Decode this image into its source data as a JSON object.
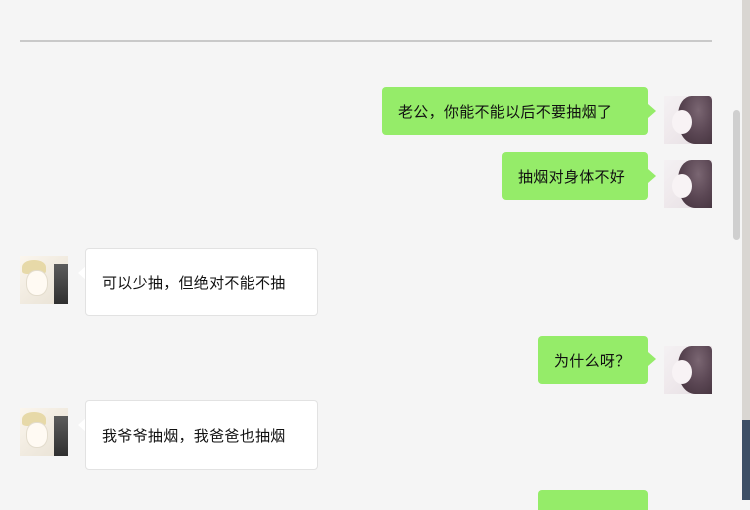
{
  "chat": {
    "messages": [
      {
        "side": "right",
        "sender": "wife",
        "text": "老公，你能不能以后不要抽烟了"
      },
      {
        "side": "right",
        "sender": "wife",
        "text": "抽烟对身体不好"
      },
      {
        "side": "left",
        "sender": "husband",
        "text": "可以少抽，但绝对不能不抽"
      },
      {
        "side": "right",
        "sender": "wife",
        "text": "为什么呀？"
      },
      {
        "side": "left",
        "sender": "husband",
        "text": "我爷爷抽烟，我爸爸也抽烟"
      }
    ]
  },
  "colors": {
    "outgoing_bubble": "#95ec69",
    "incoming_bubble": "#ffffff",
    "background": "#f5f5f5"
  },
  "icons": {
    "wife_avatar": "user-avatar-icon",
    "husband_avatar": "user-avatar-icon"
  }
}
